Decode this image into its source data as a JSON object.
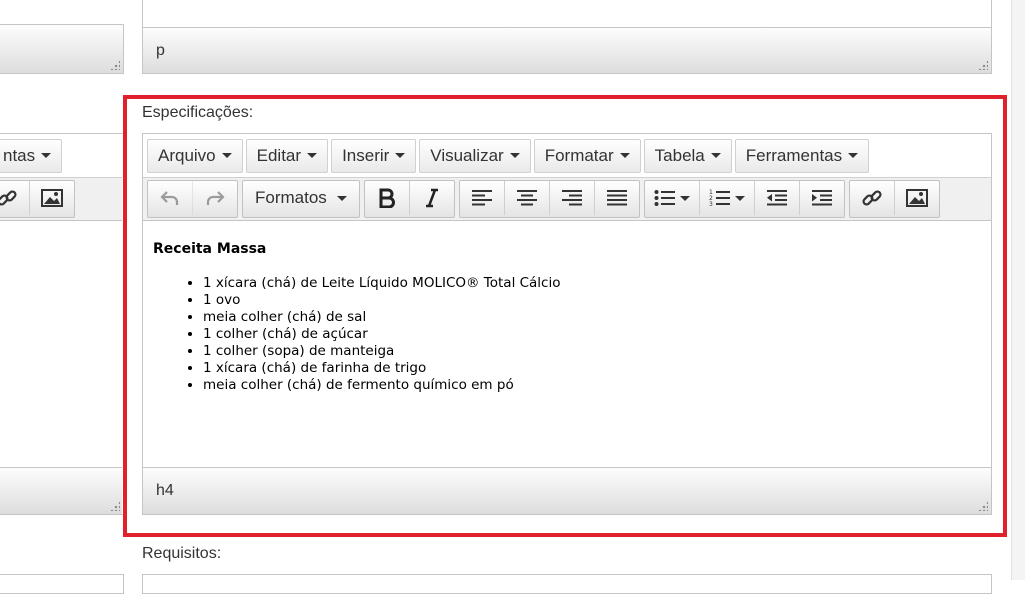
{
  "top_editor": {
    "status_path": "p"
  },
  "left_editor": {
    "menu_partial": "ntas",
    "icons": [
      "link-icon",
      "image-icon"
    ]
  },
  "specs": {
    "label": "Especificações:",
    "menubar": [
      "Arquivo",
      "Editar",
      "Inserir",
      "Visualizar",
      "Formatar",
      "Tabela",
      "Ferramentas"
    ],
    "formats_label": "Formatos",
    "content": {
      "heading": "Receita Massa",
      "items": [
        "1 xícara (chá) de Leite Líquido MOLICO® Total Cálcio",
        "1 ovo",
        "meia colher (chá) de sal",
        "1 colher (chá) de açúcar",
        "1 colher (sopa) de manteiga",
        "1 xícara (chá) de farinha de trigo",
        "meia colher (chá) de fermento químico em pó"
      ]
    },
    "status_path": "h4"
  },
  "requisitos": {
    "label": "Requisitos:"
  },
  "colors": {
    "highlight": "#e0202a",
    "border": "#c5c5c5"
  }
}
